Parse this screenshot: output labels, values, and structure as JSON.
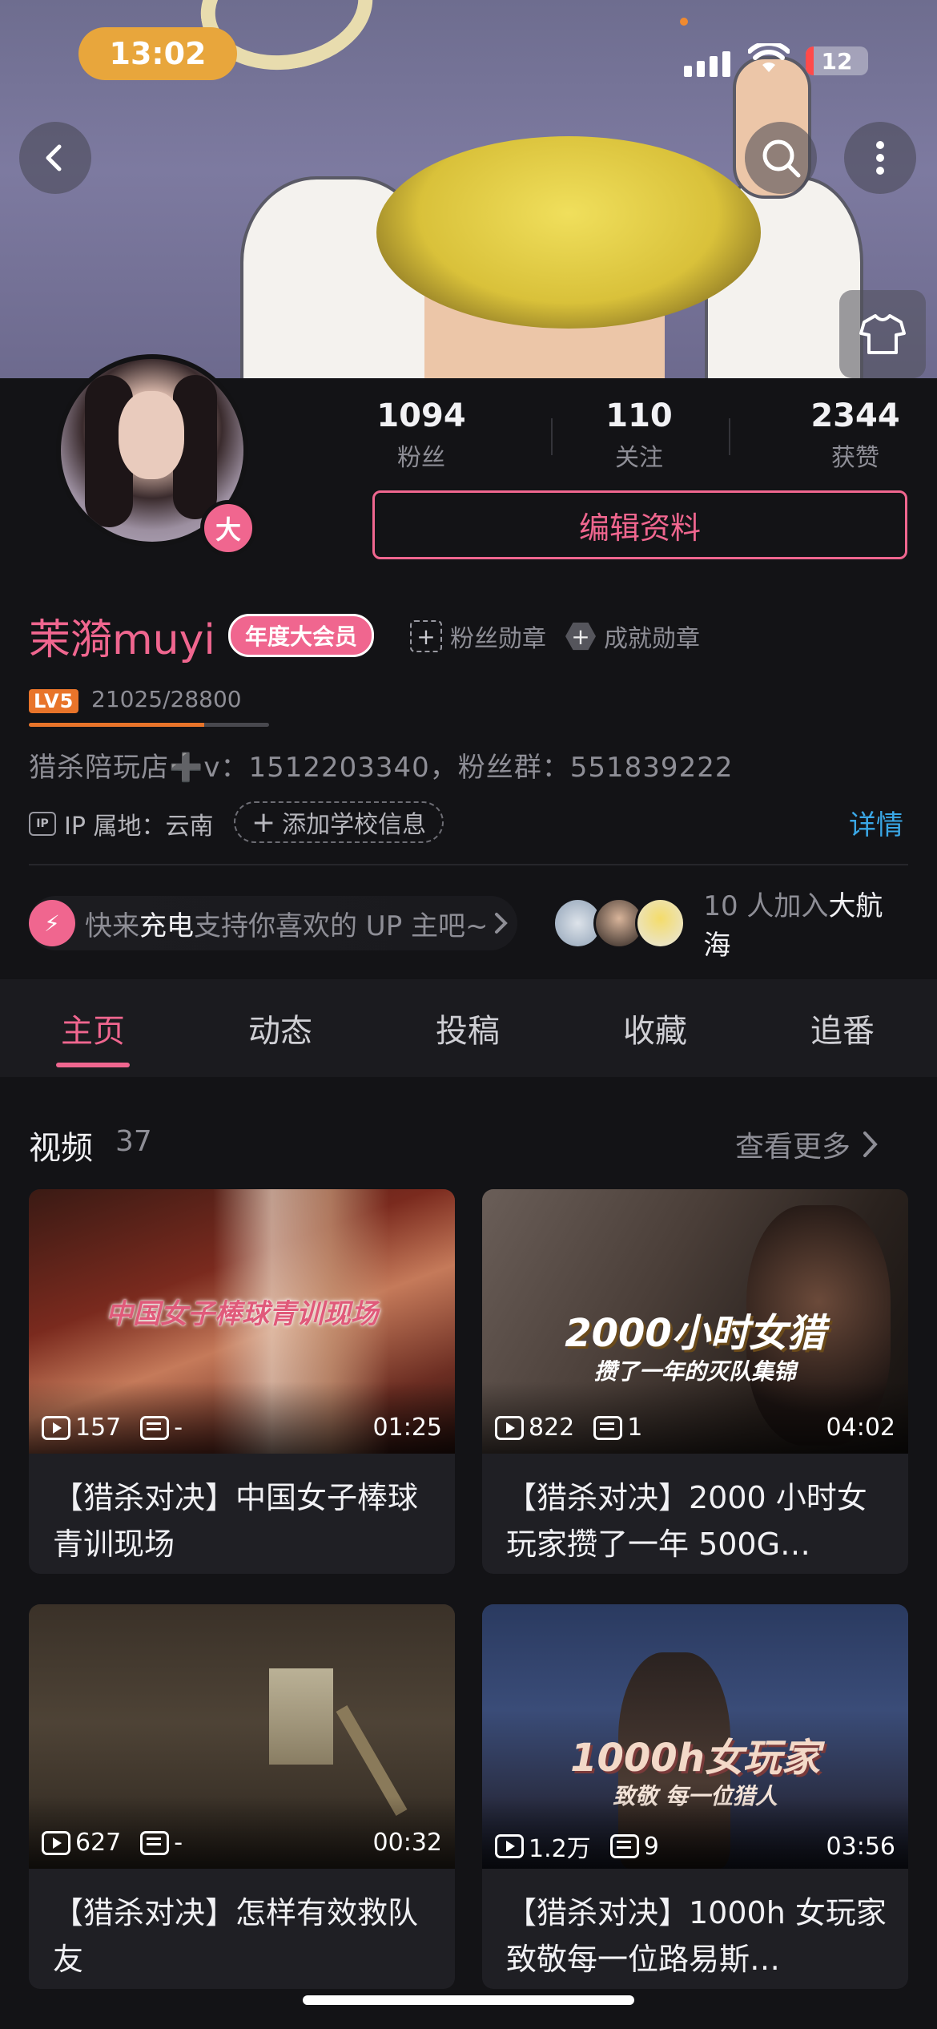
{
  "status_bar": {
    "time": "13:02",
    "battery": "12"
  },
  "stats": [
    {
      "num": "1094",
      "label": "粉丝"
    },
    {
      "num": "110",
      "label": "关注"
    },
    {
      "num": "2344",
      "label": "获赞"
    }
  ],
  "avatar_badge": "大",
  "edit_profile": "编辑资料",
  "profile": {
    "name": "茉漪muyi",
    "vip": "年度大会员",
    "fan_medal": "粉丝勋章",
    "achievement_medal": "成就勋章",
    "level": "LV5",
    "exp": "21025/28800",
    "exp_progress": 0.73,
    "sign": "猎杀陪玩店➕v：1512203340，粉丝群：551839222",
    "ip": "IP 属地：云南",
    "add_school": "添加学校信息",
    "detail": "详情"
  },
  "charge": {
    "pre": "快来",
    "bold": "充电",
    "post": "支持你喜欢的 UP 主吧~"
  },
  "fleet": {
    "pre": "10 人加入",
    "bold": "大航海"
  },
  "tabs": [
    "主页",
    "动态",
    "投稿",
    "收藏",
    "追番"
  ],
  "active_tab": "主页",
  "videos_section": {
    "title": "视频",
    "count": "37",
    "more": "查看更多"
  },
  "videos": [
    {
      "plays": "157",
      "danmaku": "-",
      "duration": "01:25",
      "title": "【猎杀对决】中国女子棒球青训现场",
      "overlay": "中国女子棒球青训现场"
    },
    {
      "plays": "822",
      "danmaku": "1",
      "duration": "04:02",
      "title": "【猎杀对决】2000 小时女玩家攒了一年 500G…",
      "overlay": "2000小时女猎",
      "overlay2": "攒了一年的灭队集锦"
    },
    {
      "plays": "627",
      "danmaku": "-",
      "duration": "00:32",
      "title": "【猎杀对决】怎样有效救队友",
      "overlay": ""
    },
    {
      "plays": "1.2万",
      "danmaku": "9",
      "duration": "03:56",
      "title": "【猎杀对决】1000h 女玩家致敬每一位路易斯…",
      "overlay": "1000h女玩家",
      "overlay2": "致敬 每一位猎人"
    }
  ],
  "colors": {
    "accent": "#f0668f",
    "link": "#3aa7e6",
    "level": "#e8742a",
    "bg": "#131316"
  }
}
